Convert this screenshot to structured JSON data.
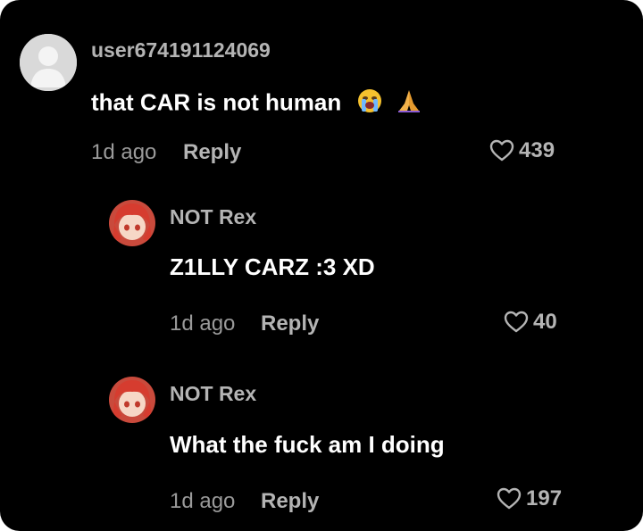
{
  "colors": {
    "background": "#000000",
    "username": "#b4b4b4",
    "text": "#ffffff",
    "meta": "#9a9a9a"
  },
  "comments": [
    {
      "username": "user674191124069",
      "text": "that CAR is not human",
      "emojis": [
        "loudly-crying-face-emoji",
        "folded-hands-emoji"
      ],
      "time": "1d ago",
      "reply_label": "Reply",
      "likes": "439",
      "avatar": "default-gray"
    }
  ],
  "replies": [
    {
      "username": "NOT Rex",
      "text": "Z1LLY CARZ :3 XD",
      "time": "1d ago",
      "reply_label": "Reply",
      "likes": "40",
      "avatar": "red-haired-character"
    },
    {
      "username": "NOT Rex",
      "text": "What the fuck am I doing",
      "time": "1d ago",
      "reply_label": "Reply",
      "likes": "197",
      "avatar": "red-haired-character"
    }
  ]
}
